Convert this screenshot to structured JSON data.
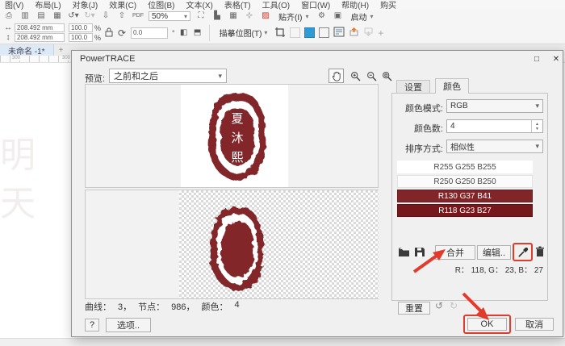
{
  "app": {
    "menu_items": [
      "图(V)",
      "布局(L)",
      "对象(J)",
      "效果(C)",
      "位图(B)",
      "文本(X)",
      "表格(T)",
      "工具(O)",
      "窗口(W)",
      "帮助(H)",
      "购买"
    ],
    "toolbar": {
      "zoom_value": "50%",
      "pdf_label": "PDF",
      "snap_label": "贴齐(I)",
      "launch_label": "启动"
    },
    "property_bar": {
      "width": "208.492 mm",
      "height": "208.492 mm",
      "scale_x": "100.0",
      "scale_y": "100.0",
      "percent_x": "%",
      "percent_y": "%",
      "rotation": "0.0",
      "degree": "°",
      "trace_button": "描摹位图(T)",
      "plus": "+"
    },
    "document_tab": "未命名 -1*",
    "new_tab": "+",
    "ruler_marks": [
      "300",
      "300"
    ],
    "canvas_ghost_chars": [
      "明",
      "天"
    ]
  },
  "dialog": {
    "title": "PowerTRACE",
    "maximize_glyph": "□",
    "close_glyph": "✕",
    "preview": {
      "label": "预览:",
      "value": "之前和之后"
    },
    "stamp": {
      "chars": [
        "夏",
        "沐",
        "熙"
      ],
      "color": "#82252a"
    },
    "status": {
      "curves_label": "曲线：",
      "curves_value": "3，",
      "nodes_label": "节点：",
      "nodes_value": "986，",
      "colors_label": "颜色：",
      "colors_value": "4"
    },
    "help_button": "?",
    "options_button": "选项..",
    "tabs": {
      "settings": "设置",
      "colors": "颜色"
    },
    "fields": {
      "mode_label": "颜色模式:",
      "mode_value": "RGB",
      "count_label": "颜色数:",
      "count_value": "4",
      "sort_label": "排序方式:",
      "sort_value": "相似性"
    },
    "swatches": [
      {
        "label": "R255 G255 B255",
        "bg": "#ffffff",
        "fg": "#4a4a4a",
        "border": "#ffffff"
      },
      {
        "label": "R250 G250 B250",
        "bg": "#fbfbfb",
        "fg": "#4a4a4a",
        "border": "#e2e2e2"
      },
      {
        "label": "R130 G37 B41",
        "bg": "#822529",
        "fg": "#ffffff",
        "border": "#6a1c20"
      },
      {
        "label": "R118 G23 B27",
        "bg": "#76171b",
        "fg": "#ffffff",
        "border": "#5e1115"
      }
    ],
    "buttons": {
      "merge": "合并",
      "edit": "编辑..",
      "reset": "重置",
      "ok": "OK",
      "cancel": "取消"
    },
    "rgb_readout": "R： 118,  G： 23,  B： 27",
    "annotation_color": "#e23b2e"
  }
}
